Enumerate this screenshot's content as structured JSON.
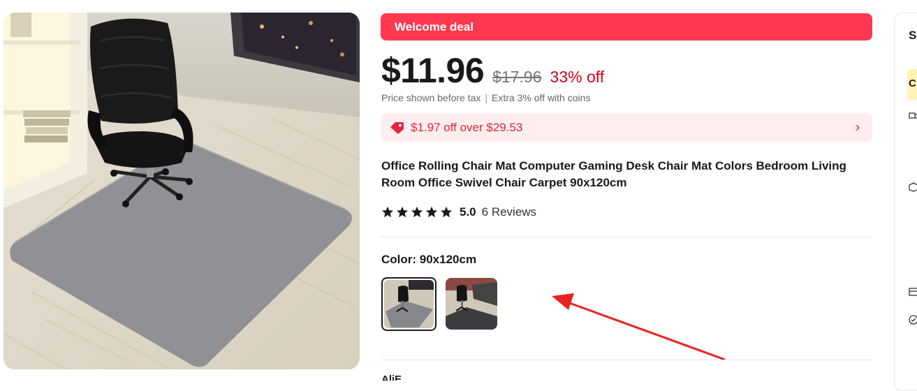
{
  "deal_banner": "Welcome deal",
  "price": {
    "current": "$11.96",
    "original": "$17.96",
    "discount": "33% off"
  },
  "tax_note": {
    "before_tax": "Price shown before tax",
    "coins": "Extra 3% off with coins"
  },
  "coupon": {
    "text": "$1.97 off over $29.53",
    "icon": "coupon-tag-icon"
  },
  "product": {
    "title": "Office Rolling Chair Mat Computer Gaming Desk Chair Mat Colors Bedroom Living Room Office Swivel Chair Carpet 90x120cm"
  },
  "rating": {
    "score": "5.0",
    "reviews": "6 Reviews",
    "stars": 5
  },
  "color": {
    "label": "Color: 90x120cm",
    "options": [
      "gray-mat-swatch",
      "black-mat-swatch"
    ]
  },
  "shipping_partial": "AliE",
  "side_panel": {
    "heading_partial": "S",
    "badge_partial": "C"
  },
  "colors": {
    "brand_red": "#fd384f",
    "discount_red": "#d3031c",
    "coupon_bg": "#ffeef0",
    "annotation_arrow": "#e8231f"
  }
}
